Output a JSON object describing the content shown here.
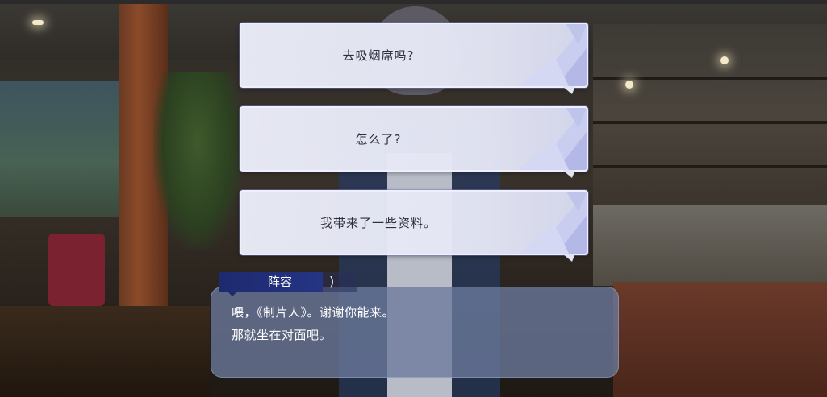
{
  "choices": [
    {
      "label": "去吸烟席吗?"
    },
    {
      "label": "怎么了?"
    },
    {
      "label": "我带来了一些资料。"
    }
  ],
  "dialogue": {
    "speaker": "阵容",
    "speaker_suffix": ")",
    "line1": "喂，《制片人》。谢谢你能来。",
    "line2": "那就坐在对面吧。"
  },
  "colors": {
    "choice_bg": "#e8eaf6",
    "choice_border": "#eef0ff",
    "nameplate": "#1e2a6e",
    "dialog_bg": "#6c7a9c"
  }
}
